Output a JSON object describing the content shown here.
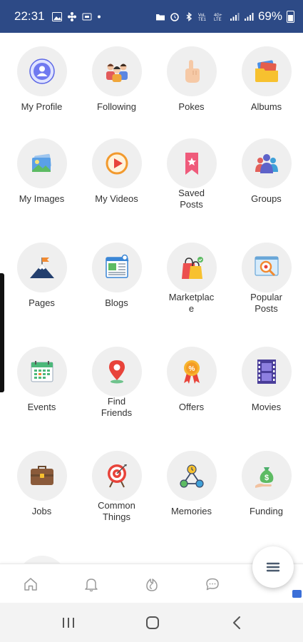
{
  "status_bar": {
    "time": "22:31",
    "battery": "69%",
    "background": "#2d4a86"
  },
  "menu": {
    "rows": [
      [
        {
          "label": "My Profile",
          "icon": "profile-icon"
        },
        {
          "label": "Following",
          "icon": "people-icon"
        },
        {
          "label": "Pokes",
          "icon": "hand-point-icon"
        },
        {
          "label": "Albums",
          "icon": "albums-icon"
        }
      ],
      [
        {
          "label": "My Images",
          "icon": "image-icon"
        },
        {
          "label": "My Videos",
          "icon": "video-play-icon"
        },
        {
          "label": "Saved\nPosts",
          "icon": "bookmark-icon"
        },
        {
          "label": "Groups",
          "icon": "groups-icon"
        }
      ],
      [
        {
          "label": "Pages",
          "icon": "flag-mountain-icon"
        },
        {
          "label": "Blogs",
          "icon": "blog-icon"
        },
        {
          "label": "Marketplac\ne",
          "icon": "shopping-bag-icon"
        },
        {
          "label": "Popular\nPosts",
          "icon": "magnifier-icon"
        }
      ],
      [
        {
          "label": "Events",
          "icon": "calendar-icon"
        },
        {
          "label": "Find\nFriends",
          "icon": "location-pin-icon"
        },
        {
          "label": "Offers",
          "icon": "discount-badge-icon"
        },
        {
          "label": "Movies",
          "icon": "film-strip-icon"
        }
      ],
      [
        {
          "label": "Jobs",
          "icon": "briefcase-icon"
        },
        {
          "label": "Common\nThings",
          "icon": "target-icon"
        },
        {
          "label": "Memories",
          "icon": "network-icon"
        },
        {
          "label": "Funding",
          "icon": "money-bag-icon"
        }
      ]
    ]
  },
  "bottom_nav": {
    "items": [
      "home-icon",
      "bell-icon",
      "fire-icon",
      "chat-icon"
    ],
    "menu_button_icon": "hamburger-icon"
  },
  "system_nav": {
    "items": [
      "recents-icon",
      "home-button-icon",
      "back-icon"
    ]
  }
}
